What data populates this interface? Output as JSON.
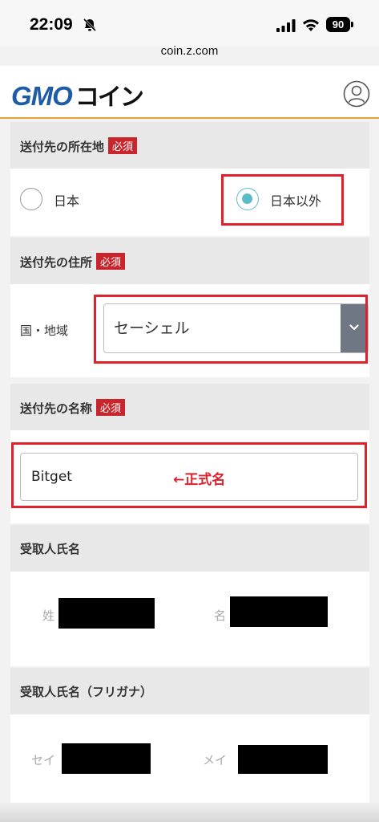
{
  "status_bar": {
    "time": "22:09",
    "battery": "90"
  },
  "browser": {
    "url": "coin.z.com"
  },
  "header": {
    "logo_gmo": "GMO",
    "logo_coin": "コイン"
  },
  "required_badge": "必須",
  "sections": {
    "location": {
      "title": "送付先の所在地",
      "options": [
        {
          "label": "日本",
          "selected": false
        },
        {
          "label": "日本以外",
          "selected": true
        }
      ]
    },
    "address": {
      "title": "送付先の住所",
      "field_label": "国・地域",
      "selected_value": "セーシェル"
    },
    "name": {
      "title": "送付先の名称",
      "input_value": "Bitget",
      "annotation": "←正式名"
    },
    "recipient": {
      "title": "受取人氏名",
      "last_name_label": "姓",
      "first_name_label": "名"
    },
    "recipient_kana": {
      "title": "受取人氏名（フリガナ）",
      "last_name_label": "セイ",
      "first_name_label": "メイ"
    }
  },
  "colors": {
    "accent_red": "#e0202a",
    "radio_teal": "#5bbcc9",
    "brand_blue": "#1e5ca8",
    "header_rule": "#e8a23a"
  }
}
